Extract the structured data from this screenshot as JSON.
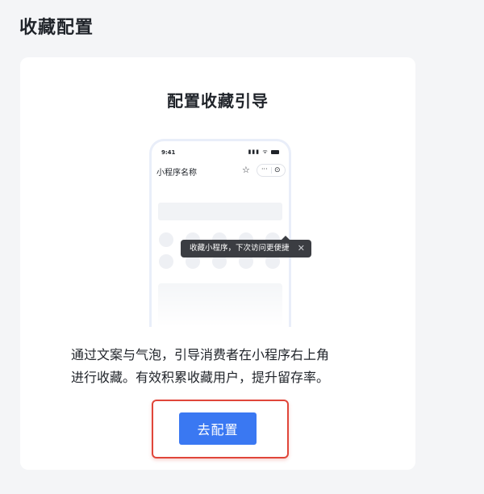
{
  "page": {
    "title": "收藏配置"
  },
  "card": {
    "title": "配置收藏引导",
    "description_line1": "通过文案与气泡，引导消费者在小程序右上角",
    "description_line2": "进行收藏。有效积累收藏用户，提升留存率。",
    "button_label": "去配置"
  },
  "illustration": {
    "status_time": "9:41",
    "app_name": "小程序名称",
    "capsule_dots": "···",
    "tooltip_text": "收藏小程序，下次访问更便捷",
    "tooltip_close": "✕",
    "star_icon": "☆",
    "target_icon": "⊙",
    "signal_icons": "▮▮▮ ᯤ"
  },
  "colors": {
    "primary": "#3a78f2",
    "highlight": "#e0463a",
    "tooltip_bg": "#3b3d42"
  }
}
